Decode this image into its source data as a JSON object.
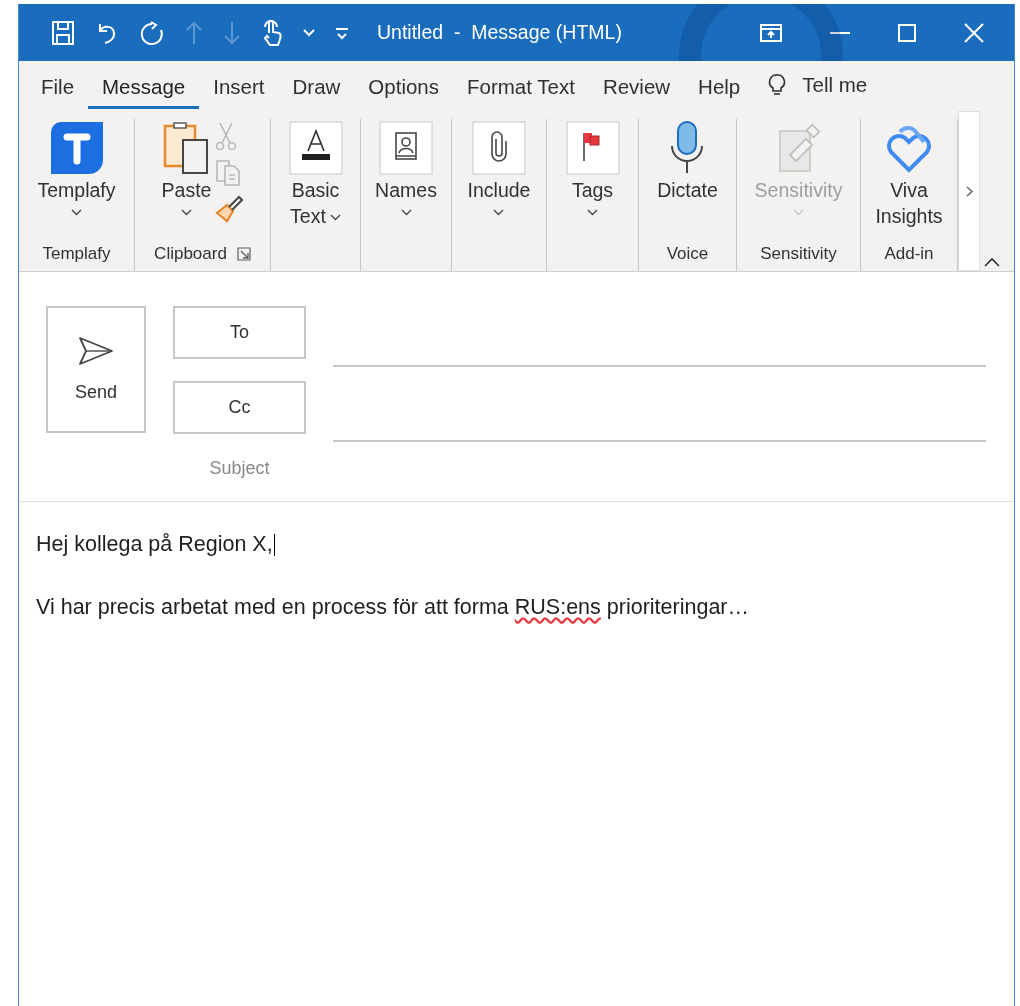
{
  "window": {
    "title": "Untitled  -  Message (HTML)"
  },
  "tabs": [
    {
      "label": "File",
      "selected": false
    },
    {
      "label": "Message",
      "selected": true
    },
    {
      "label": "Insert",
      "selected": false
    },
    {
      "label": "Draw",
      "selected": false
    },
    {
      "label": "Options",
      "selected": false
    },
    {
      "label": "Format Text",
      "selected": false
    },
    {
      "label": "Review",
      "selected": false
    },
    {
      "label": "Help",
      "selected": false
    }
  ],
  "tell_me": "Tell me",
  "ribbon": {
    "groups": [
      {
        "label": "Templafy",
        "buttons": [
          {
            "kind": "templafy",
            "label": "Templafy",
            "dropdown": true,
            "disabled": false
          }
        ]
      },
      {
        "label": "Clipboard",
        "launcher": true,
        "buttons": [
          {
            "kind": "paste",
            "label": "Paste",
            "dropdown": true,
            "disabled": false
          }
        ],
        "small_buttons": [
          {
            "kind": "cut",
            "disabled": true
          },
          {
            "kind": "copy",
            "disabled": true
          },
          {
            "kind": "format-painter",
            "disabled": false
          }
        ]
      },
      {
        "buttons": [
          {
            "kind": "basic-text",
            "label": "Basic Text",
            "dropdown": true,
            "disabled": false
          }
        ]
      },
      {
        "buttons": [
          {
            "kind": "names",
            "label": "Names",
            "dropdown": true,
            "disabled": false
          }
        ]
      },
      {
        "buttons": [
          {
            "kind": "include",
            "label": "Include",
            "dropdown": true,
            "disabled": false
          }
        ]
      },
      {
        "buttons": [
          {
            "kind": "tags",
            "label": "Tags",
            "dropdown": true,
            "disabled": false
          }
        ]
      },
      {
        "label": "Voice",
        "buttons": [
          {
            "kind": "dictate",
            "label": "Dictate",
            "disabled": false
          }
        ]
      },
      {
        "label": "Sensitivity",
        "buttons": [
          {
            "kind": "sensitivity",
            "label": "Sensitivity",
            "dropdown": true,
            "disabled": true
          }
        ]
      },
      {
        "label": "Add-in",
        "buttons": [
          {
            "kind": "viva",
            "label": "Viva Insights",
            "disabled": false
          }
        ]
      }
    ]
  },
  "compose": {
    "send": "Send",
    "to": "To",
    "cc": "Cc",
    "subject": "Subject"
  },
  "body": {
    "paragraphs": [
      {
        "caret": true,
        "segments": [
          {
            "text": "Hej kollega på Region X,",
            "misspelled": false
          }
        ]
      },
      {
        "segments": [
          {
            "text": "Vi har precis arbetat med en process för att forma ",
            "misspelled": false
          },
          {
            "text": "RUS:ens",
            "misspelled": true
          },
          {
            "text": " prioriteringar…",
            "misspelled": false
          }
        ]
      }
    ]
  }
}
